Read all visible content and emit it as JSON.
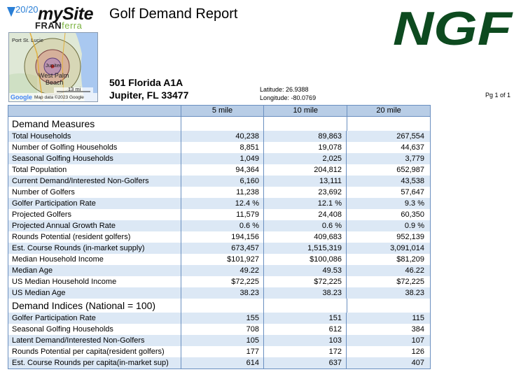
{
  "logo": {
    "number": "20/20",
    "brand": "mySite",
    "sub_a": "FRAN",
    "sub_b": "ferra"
  },
  "title": "Golf Demand Report",
  "ngf_logo_text": "NGF",
  "map": {
    "labels": [
      "Port St. Lucie",
      "Jupiter",
      "West Palm",
      "Beach"
    ],
    "scale": "13 mi",
    "google": "Google",
    "attribution": "Map data ©2023 Google"
  },
  "address": {
    "line1": "501 Florida A1A",
    "line2": "Jupiter, FL 33477"
  },
  "coords": {
    "latitude": "Latitude: 26.9388",
    "longitude": "Longitude: -80.0769"
  },
  "page_number": "Pg 1 of 1",
  "table": {
    "columns": [
      "5 mile",
      "10 mile",
      "20 mile"
    ],
    "sections": [
      {
        "title": "Demand Measures",
        "rows": [
          {
            "label": "Total Households",
            "values": [
              "40,238",
              "89,863",
              "267,554"
            ]
          },
          {
            "label": "Number of Golfing Households",
            "values": [
              "8,851",
              "19,078",
              "44,637"
            ]
          },
          {
            "label": "Seasonal Golfing Households",
            "values": [
              "1,049",
              "2,025",
              "3,779"
            ]
          },
          {
            "label": "Total Population",
            "values": [
              "94,364",
              "204,812",
              "652,987"
            ]
          },
          {
            "label": "Current Demand/Interested Non-Golfers",
            "values": [
              "6,160",
              "13,111",
              "43,538"
            ]
          },
          {
            "label": "Number of Golfers",
            "values": [
              "11,238",
              "23,692",
              "57,647"
            ]
          },
          {
            "label": "Golfer Participation Rate",
            "values": [
              "12.4 %",
              "12.1 %",
              "9.3 %"
            ]
          },
          {
            "label": "Projected Golfers",
            "values": [
              "11,579",
              "24,408",
              "60,350"
            ]
          },
          {
            "label": "Projected Annual Growth Rate",
            "values": [
              "0.6 %",
              "0.6 %",
              "0.9 %"
            ]
          },
          {
            "label": "Rounds Potential (resident golfers)",
            "values": [
              "194,156",
              "409,683",
              "952,139"
            ]
          },
          {
            "label": "Est. Course Rounds (in-market supply)",
            "values": [
              "673,457",
              "1,515,319",
              "3,091,014"
            ]
          },
          {
            "label": "Median Household Income",
            "values": [
              "$101,927",
              "$100,086",
              "$81,209"
            ]
          },
          {
            "label": "Median Age",
            "values": [
              "49.22",
              "49.53",
              "46.22"
            ]
          },
          {
            "label": "US Median Household Income",
            "values": [
              "$72,225",
              "$72,225",
              "$72,225"
            ]
          },
          {
            "label": "US Median Age",
            "values": [
              "38.23",
              "38.23",
              "38.23"
            ]
          }
        ]
      },
      {
        "title": "Demand Indices (National = 100)",
        "rows": [
          {
            "label": "Golfer Participation Rate",
            "values": [
              "155",
              "151",
              "115"
            ]
          },
          {
            "label": "Seasonal Golfing Households",
            "values": [
              "708",
              "612",
              "384"
            ]
          },
          {
            "label": "Latent Demand/Interested Non-Golfers",
            "values": [
              "105",
              "103",
              "107"
            ]
          },
          {
            "label": "Rounds Potential per capita(resident golfers)",
            "values": [
              "177",
              "172",
              "126"
            ]
          },
          {
            "label": "Est. Course Rounds per capita(in-market sup)",
            "values": [
              "614",
              "637",
              "407"
            ]
          }
        ]
      }
    ]
  }
}
